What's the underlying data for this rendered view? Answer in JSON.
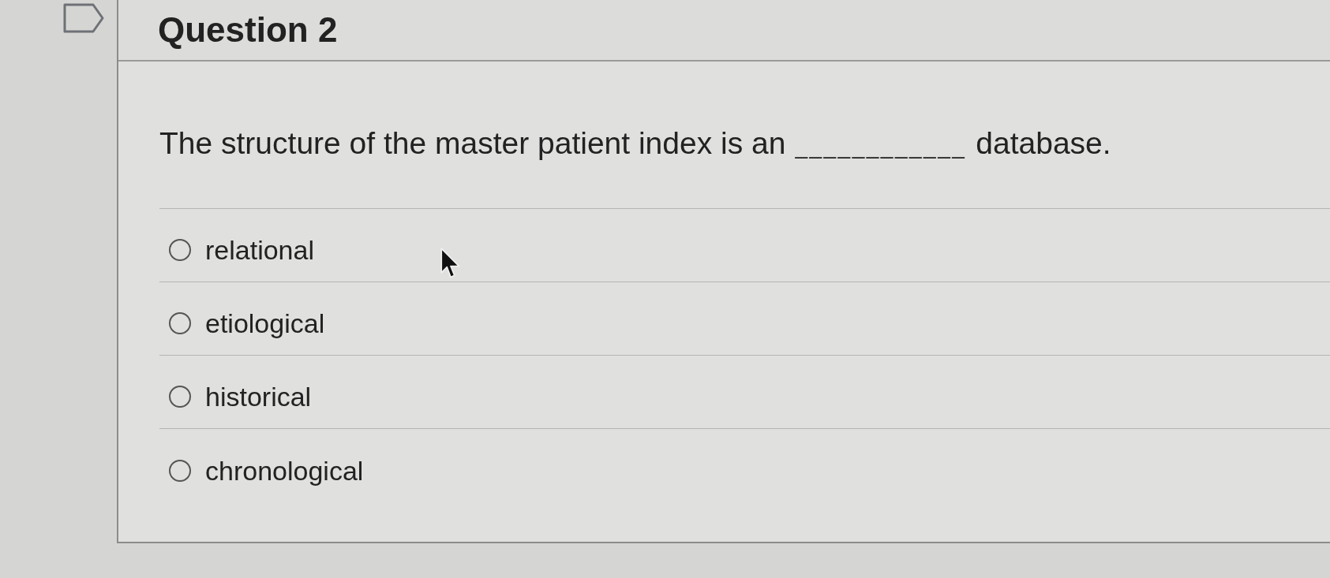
{
  "question": {
    "title": "Question 2",
    "prompt": {
      "before": "The structure of the master patient index is an",
      "blank": "____________",
      "after": "database."
    }
  },
  "options": [
    {
      "label": "relational",
      "selected": false
    },
    {
      "label": "etiological",
      "selected": false
    },
    {
      "label": "historical",
      "selected": false
    },
    {
      "label": "chronological",
      "selected": false
    }
  ]
}
